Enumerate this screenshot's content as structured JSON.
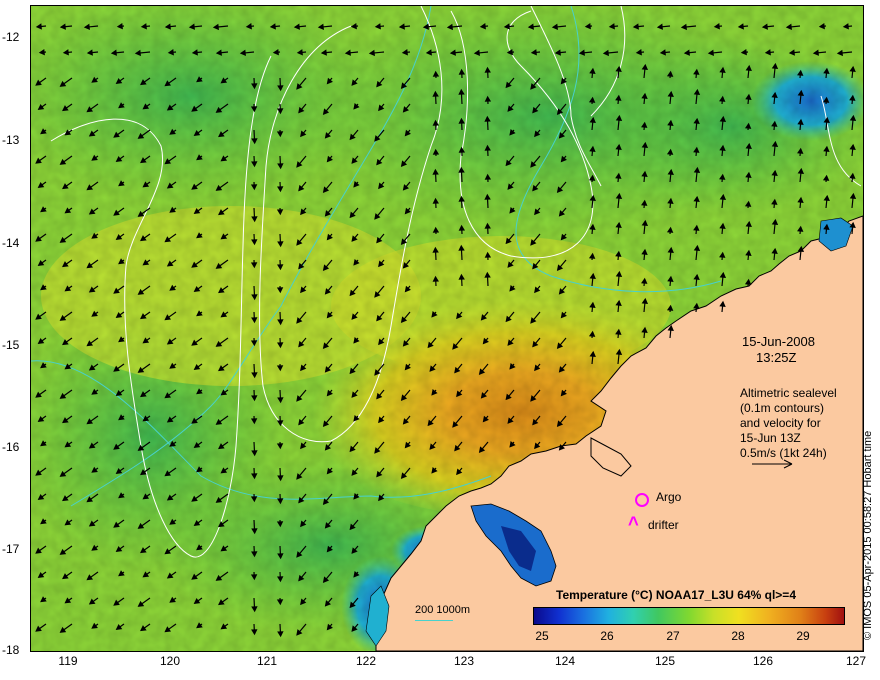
{
  "map": {
    "date": "15-Jun-2008",
    "time": "13:25Z",
    "description_lines": [
      "Altimetric sealevel",
      "(0.1m contours)",
      "and velocity for",
      "15-Jun 13Z",
      "0.5m/s (1kt 24h)"
    ],
    "legend": {
      "argo": "Argo",
      "drifter": "drifter"
    },
    "scale_bar": "200  1000m",
    "credit": "© IMOS 05-Apr-2015 00:58:27 Hobart time",
    "colorbar": {
      "title": "Temperature (°C) NOAA17_L3U 64% ql>=4",
      "ticks": [
        "25",
        "26",
        "27",
        "28",
        "29"
      ]
    },
    "x_ticks": [
      "119",
      "120",
      "121",
      "122",
      "123",
      "124",
      "125",
      "126",
      "127"
    ],
    "y_ticks": [
      "-12",
      "-13",
      "-14",
      "-15",
      "-16",
      "-17",
      "-18"
    ],
    "colors": {
      "land": "#fbc9a0",
      "contour": "#ffffff",
      "bathymetry": "#48d1cc",
      "argo": "#ff00ff"
    }
  }
}
